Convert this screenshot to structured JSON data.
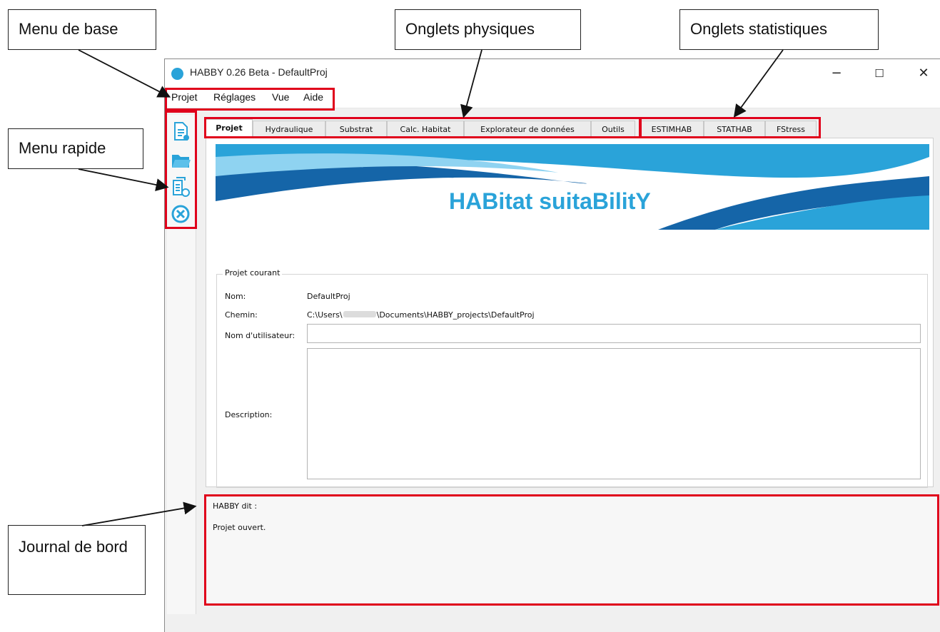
{
  "callouts": {
    "menu_de_base": "Menu de base",
    "onglets_physiques": "Onglets physiques",
    "onglets_statistiques": "Onglets statistiques",
    "menu_rapide": "Menu rapide",
    "journal_de_bord": "Journal de bord"
  },
  "window": {
    "title": "HABBY 0.26 Beta - DefaultProj",
    "minimize": "−",
    "maximize": "☐",
    "close": "✕"
  },
  "menu": {
    "items": [
      "Projet",
      "Réglages",
      "Vue",
      "Aide"
    ]
  },
  "quick_menu": {
    "icons": [
      "new-project-icon",
      "open-folder-icon",
      "copy-project-icon",
      "close-project-icon"
    ]
  },
  "tabs": {
    "physical": [
      "Projet",
      "Hydraulique",
      "Substrat",
      "Calc. Habitat",
      "Explorateur de données",
      "Outils"
    ],
    "statistical": [
      "ESTIMHAB",
      "STATHAB",
      "FStress"
    ],
    "active": "Projet"
  },
  "banner": {
    "title": "HABitat suitaBilitY",
    "colors": {
      "accent": "#2aa3d9",
      "dark": "#1565a8"
    }
  },
  "project": {
    "group_label": "Projet courant",
    "name_label": "Nom:",
    "name_value": "DefaultProj",
    "path_label": "Chemin:",
    "path_value": "C:\\Users\\",
    "path_value_end": "\\Documents\\HABBY_projects\\DefaultProj",
    "user_label": "Nom d'utilisateur:",
    "user_value": "",
    "description_label": "Description:",
    "description_value": ""
  },
  "log": {
    "title": "HABBY dit :",
    "message": "Projet ouvert."
  },
  "highlight_color": "#e0001b"
}
